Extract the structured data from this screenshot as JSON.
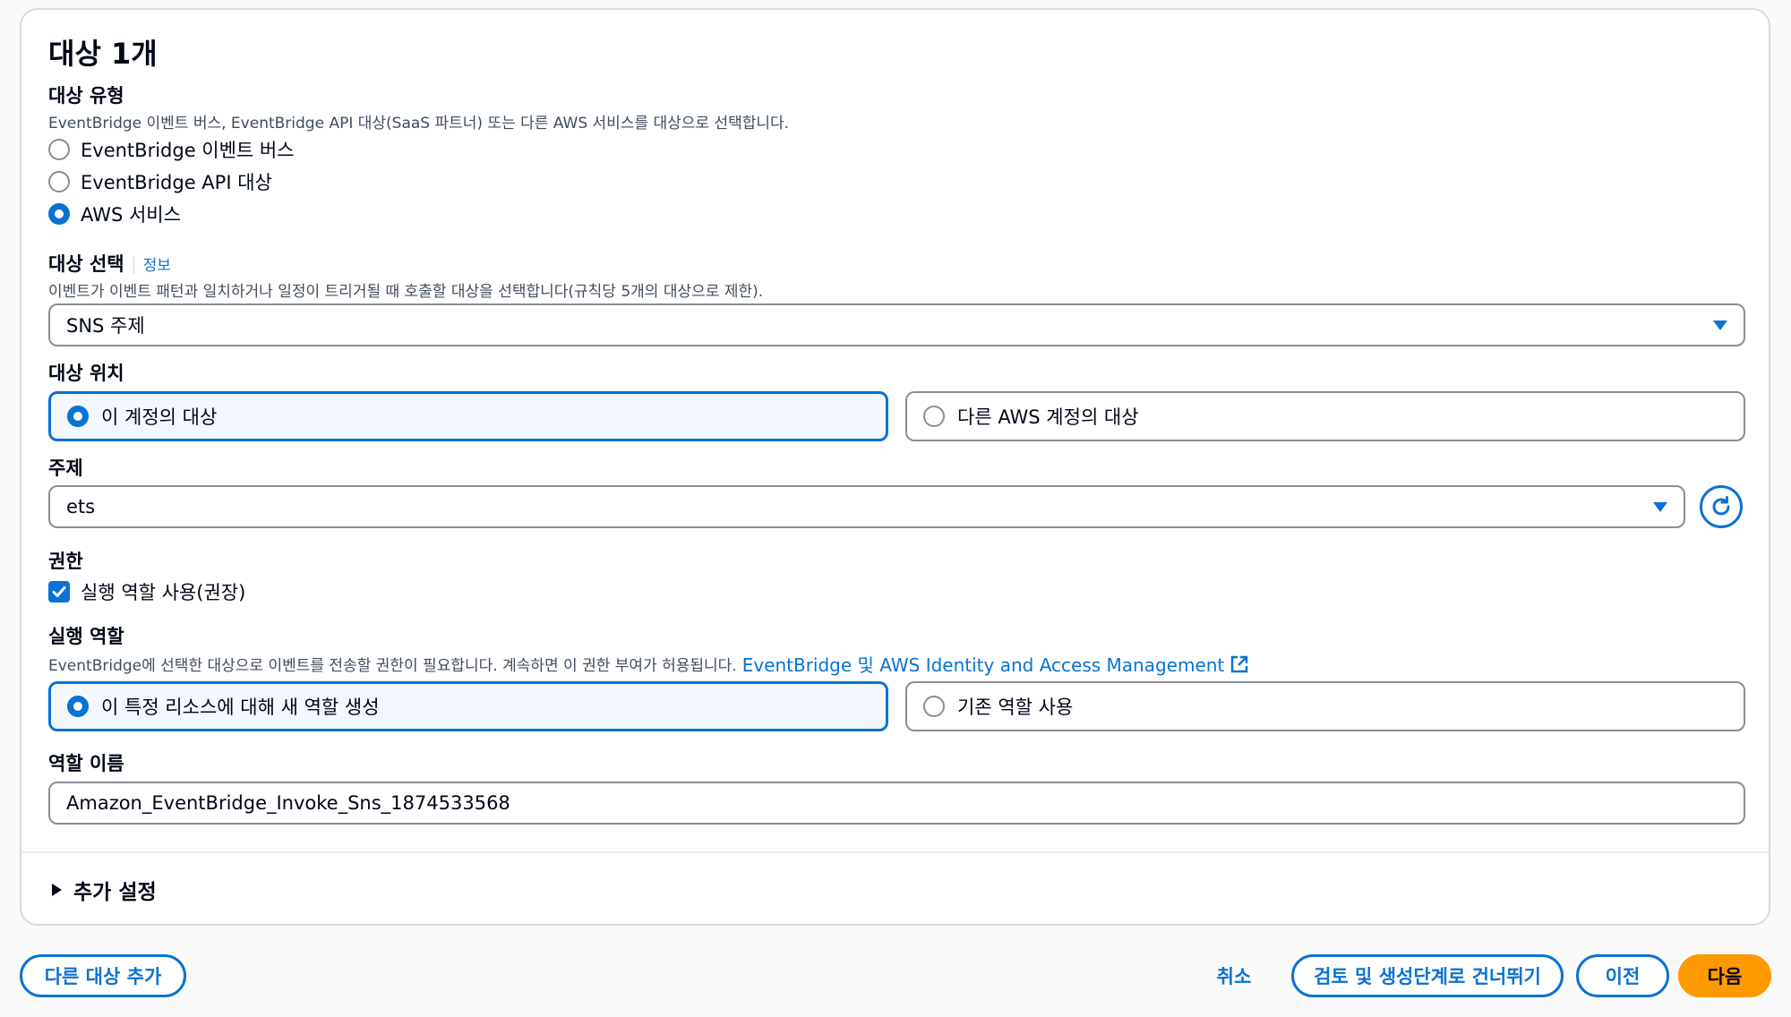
{
  "section": {
    "title": "대상 1개"
  },
  "target_type": {
    "label": "대상 유형",
    "description": "EventBridge 이벤트 버스, EventBridge API 대상(SaaS 파트너) 또는 다른 AWS 서비스를 대상으로 선택합니다.",
    "options": [
      "EventBridge 이벤트 버스",
      "EventBridge API 대상",
      "AWS 서비스"
    ],
    "selected": "AWS 서비스"
  },
  "target_select": {
    "label": "대상 선택",
    "info_link": "정보",
    "description": "이벤트가 이벤트 패턴과 일치하거나 일정이 트리거될 때 호출할 대상을 선택합니다(규칙당 5개의 대상으로 제한).",
    "value": "SNS 주제"
  },
  "target_location": {
    "label": "대상 위치",
    "options": [
      "이 계정의 대상",
      "다른 AWS 계정의 대상"
    ],
    "selected": "이 계정의 대상"
  },
  "topic": {
    "label": "주제",
    "value": "ets"
  },
  "permissions": {
    "label": "권한",
    "checkbox_label": "실행 역할 사용(권장)",
    "checked": true
  },
  "execution_role": {
    "label": "실행 역할",
    "description": "EventBridge에 선택한 대상으로 이벤트를 전송할 권한이 필요합니다. 계속하면 이 권한 부여가 허용됩니다.",
    "link_text": "EventBridge 및 AWS Identity and Access Management",
    "options": [
      "이 특정 리소스에 대해 새 역할 생성",
      "기존 역할 사용"
    ],
    "selected": "이 특정 리소스에 대해 새 역할 생성"
  },
  "role_name": {
    "label": "역할 이름",
    "value": "Amazon_EventBridge_Invoke_Sns_1874533568"
  },
  "additional_settings": {
    "label": "추가 설정"
  },
  "footer": {
    "add_target": "다른 대상 추가",
    "cancel": "취소",
    "skip": "검토 및 생성단계로 건너뛰기",
    "previous": "이전",
    "next": "다음"
  },
  "colors": {
    "accent": "#0972d3",
    "primary_button": "#ff9900"
  }
}
